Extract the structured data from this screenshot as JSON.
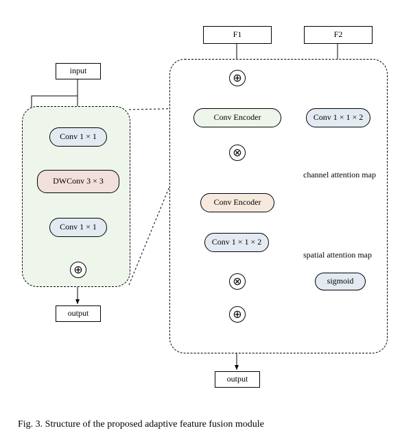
{
  "left": {
    "input": "input",
    "conv1": "Conv 1 × 1",
    "dwconv": "DWConv 3 × 3",
    "conv2": "Conv 1 × 1",
    "output": "output"
  },
  "right": {
    "f1": "F1",
    "f2": "F2",
    "conv_encoder": "Conv Encoder",
    "conv1_n2": "Conv 1 × 1 × 2",
    "conv_encoder2": "Conv Encoder",
    "conv1_n2_b": "Conv 1 × 1 × 2",
    "sigmoid": "sigmoid",
    "output": "output"
  },
  "labels": {
    "channel": "channel attention map",
    "spatial": "spatial attention map"
  },
  "caption": "Fig. 3.   Structure of the proposed adaptive feature fusion module",
  "colors": {
    "green": "#eef6ec",
    "blue": "#e4eaf2",
    "red": "#f1e0dc",
    "orange": "#f6e9de",
    "slab": "#9cacc7",
    "slab_dark": "#6f80a0",
    "white": "#ffffff"
  }
}
